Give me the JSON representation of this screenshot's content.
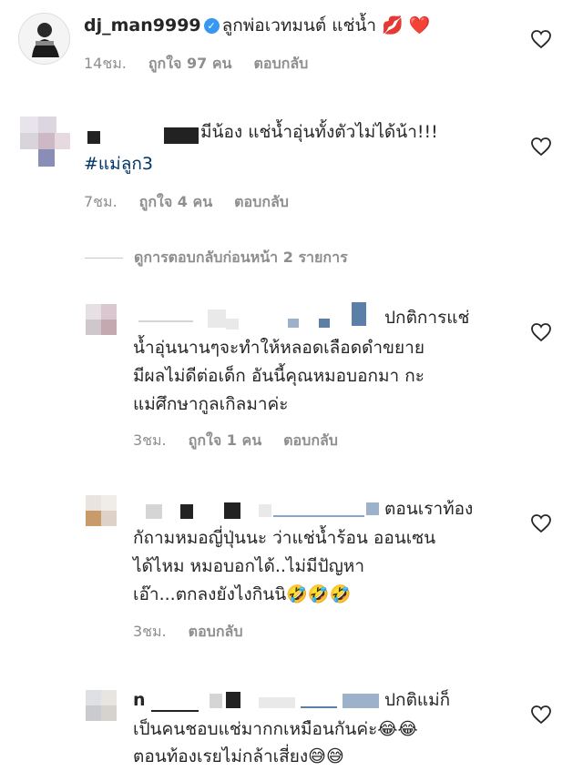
{
  "comments": [
    {
      "username": "dj_man9999",
      "text": "ลูกพ่อเวทมนต์ แช่น้ำ",
      "emoji": "💋 ❤️",
      "time": "14ชม.",
      "likes": "ถูกใจ 97 คน",
      "reply": "ตอบกลับ"
    },
    {
      "text": "มีน้อง แช่น้ำอุ่นทั้งตัวไม่ได้น้า!!!",
      "hashtag": "#แม่ลูก3",
      "time": "7ชม.",
      "likes": "ถูกใจ 4 คน",
      "reply": "ตอบกลับ"
    }
  ],
  "view_replies": "ดูการตอบกลับก่อนหน้า 2 รายการ",
  "replies": [
    {
      "lines": [
        "ปกติการแช่",
        "น้ำอุ่นนานๆจะทำให้หลอดเลือดดำขยาย",
        "มีผลไม่ดีต่อเด็ก อันนี้คุณหมอบอกมา กะ",
        "แม่ศึกษากูลเกิลมาค่ะ"
      ],
      "time": "3ชม.",
      "likes": "ถูกใจ 1 คน",
      "reply": "ตอบกลับ"
    },
    {
      "lines": [
        "ตอนเราท้อง",
        "กัถามหมอญี่ปุ่นนะ ว่าแช่น้ำร้อน ออนเซน",
        "ได้ไหม หมอบอกได้..ไม่มีปัญหา",
        "เอ๊า...ตกลงยังไงกินนิ🤣🤣🤣"
      ],
      "time": "3ชม.",
      "reply": "ตอบกลับ"
    },
    {
      "username_fragment": "n",
      "lines": [
        "ปกติแม่ก็",
        "เป็นคนชอบแช่มากกเหมือนกันค่ะ😂😂",
        "ตอนท้องเรยไม่กล้าเสี่ยง😅😅"
      ]
    }
  ],
  "icons": {
    "like": "heart-outline-icon",
    "verified": "verified-badge-icon"
  },
  "colors": {
    "text": "#262626",
    "meta": "#8e8e8e",
    "hashtag": "#003569",
    "verified": "#3897f0"
  }
}
